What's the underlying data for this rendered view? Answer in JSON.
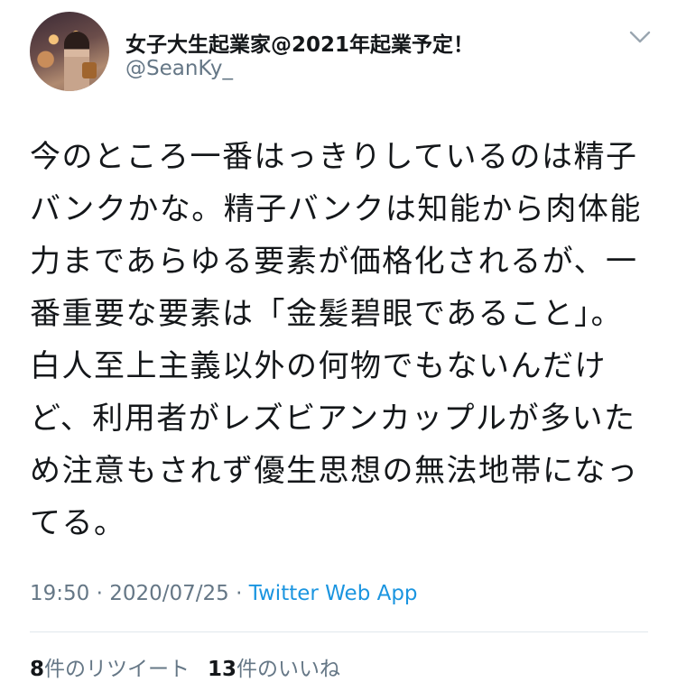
{
  "user": {
    "display_name": "女子大生起業家@2021年起業予定！",
    "handle": "@SeanKy_"
  },
  "tweet": {
    "text": "今のところ一番はっきりしているのは精子バンクかな。精子バンクは知能から肉体能力まであらゆる要素が価格化されるが、一番重要な要素は「金髪碧眼であること」。白人至上主義以外の何物でもないんだけど、利用者がレズビアンカップルが多いため注意もされず優生思想の無法地帯になってる。",
    "time": "19:50",
    "sep1": " · ",
    "date": "2020/07/25",
    "sep2": " · ",
    "source": "Twitter Web App"
  },
  "stats": {
    "retweets_count": "8",
    "retweets_label": "件のリツイート",
    "likes_count": "13",
    "likes_label": "件のいいね"
  },
  "icons": {
    "menu": "chevron-down-icon"
  },
  "colors": {
    "text": "#14171a",
    "secondary": "#657786",
    "link": "#1b95e0",
    "divider": "#e1e8ed"
  }
}
